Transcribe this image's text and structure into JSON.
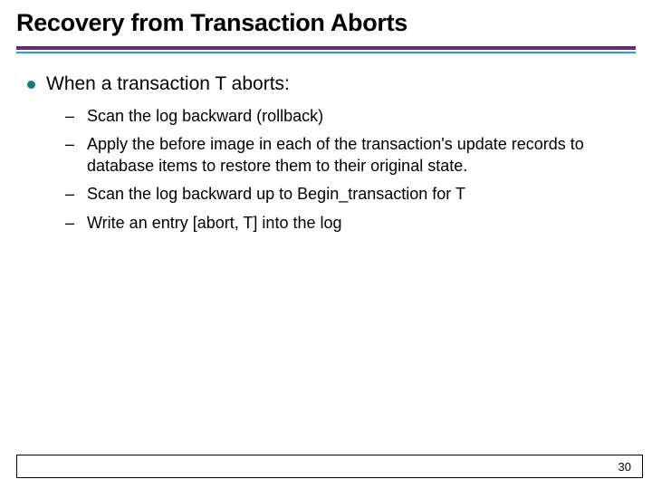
{
  "title": "Recovery from Transaction Aborts",
  "main_bullet": "When a transaction T aborts:",
  "sub_items": [
    "Scan the log backward (rollback)",
    "Apply the before image in each of the transaction's update records to database items to restore them to their original state.",
    "Scan the log backward up to Begin_transaction for T",
    "Write an entry [abort, T] into the log"
  ],
  "page_number": "30"
}
